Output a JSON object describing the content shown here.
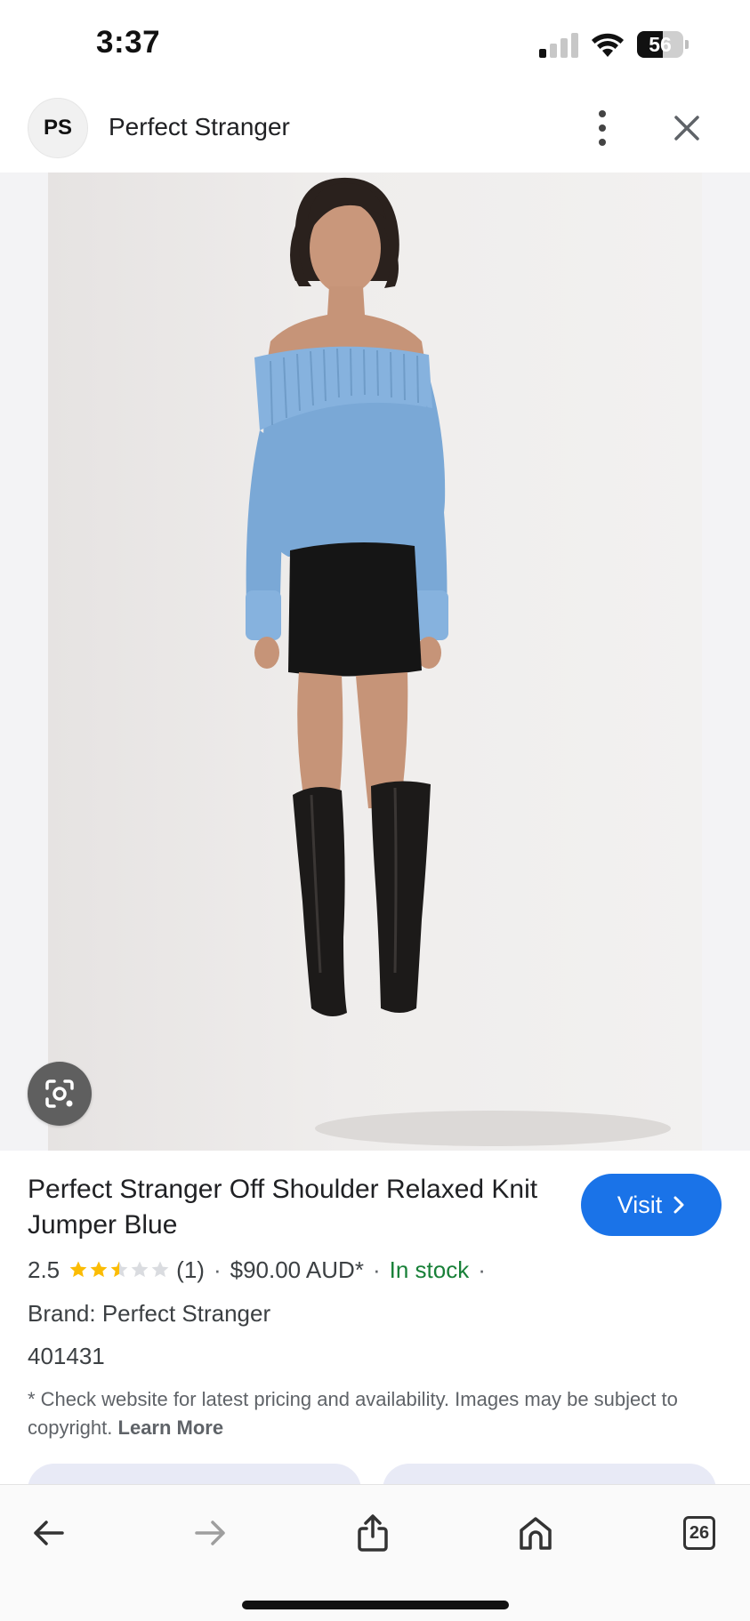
{
  "status_bar": {
    "time": "3:37",
    "battery_level": "56",
    "signal_bars_active": 1,
    "signal_bars_total": 4
  },
  "site": {
    "logo_text": "PS",
    "name": "Perfect Stranger"
  },
  "product": {
    "title": "Perfect Stranger Off Shoulder Relaxed Knit Jumper Blue",
    "rating_value": "2.5",
    "rating_stars": 2.5,
    "review_count": "(1)",
    "price": "$90.00 AUD*",
    "availability": "In stock",
    "brand": "Brand: Perfect Stranger",
    "sku": "401431",
    "disclaimer": "* Check website for latest pricing and availability. Images may be subject to copyright.",
    "learn_more": "Learn More"
  },
  "visit_button": {
    "label": "Visit"
  },
  "toolbar": {
    "tabs_count": "26"
  },
  "icons": {
    "more": "more-vert-icon",
    "close": "close-icon",
    "lens": "lens-icon",
    "back": "back-arrow-icon",
    "forward": "forward-arrow-icon",
    "share": "share-icon",
    "home": "home-icon"
  },
  "colors": {
    "accent": "#1a73e8",
    "in_stock": "#188038",
    "star_filled": "#fbbc04",
    "star_empty": "#dadce0"
  }
}
